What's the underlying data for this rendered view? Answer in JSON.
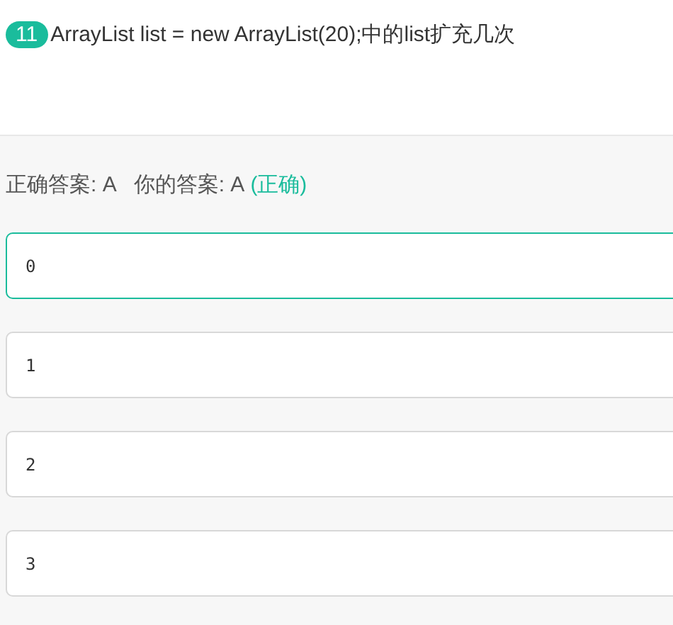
{
  "question": {
    "number": "11",
    "text": "ArrayList list = new ArrayList(20);中的list扩充几次"
  },
  "result": {
    "correct_answer": "正确答案: A",
    "your_answer": "你的答案: A",
    "verdict": "(正确)",
    "is_correct": true
  },
  "options": [
    {
      "text": "0",
      "selected": true
    },
    {
      "text": "1",
      "selected": false
    },
    {
      "text": "2",
      "selected": false
    },
    {
      "text": "3",
      "selected": false
    }
  ]
}
